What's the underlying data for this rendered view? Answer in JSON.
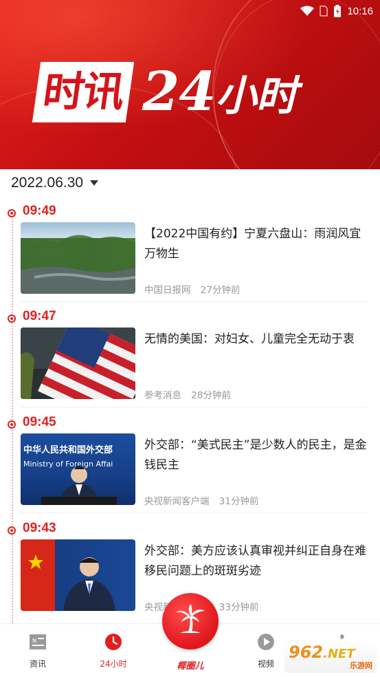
{
  "status_bar": {
    "time": "10:16"
  },
  "banner": {
    "title_boxed": "时讯",
    "title_num": "24",
    "title_rest": "小时"
  },
  "date": {
    "value": "2022.06.30"
  },
  "news": [
    {
      "time": "09:49",
      "headline": "【2022中国有约】宁夏六盘山：雨润风宜万物生",
      "source": "中国日报网",
      "ago": "27分钟前"
    },
    {
      "time": "09:47",
      "headline": "无情的美国：对妇女、儿童完全无动于衷",
      "source": "参考消息",
      "ago": "28分钟前"
    },
    {
      "time": "09:45",
      "headline": "外交部：“美式民主”是少数人的民主，是金钱民主",
      "source": "央视新闻客户端",
      "ago": "31分钟前",
      "thumb_text_1": "中华人民共和国外交部",
      "thumb_text_2": "Ministry of Foreign Affai"
    },
    {
      "time": "09:43",
      "headline": "外交部：美方应该认真审视并纠正自身在难移民问题上的斑斑劣迹",
      "source": "央视新闻客户端",
      "ago": "33分钟前"
    }
  ],
  "bottom_nav": {
    "news": "资讯",
    "hours24": "24小时",
    "center": "椰圈儿",
    "video": "视频"
  },
  "watermark": {
    "main": "962",
    "net": ".NET",
    "sub": "乐游网"
  },
  "colors": {
    "accent": "#e02020",
    "banner": "#d4141b"
  }
}
